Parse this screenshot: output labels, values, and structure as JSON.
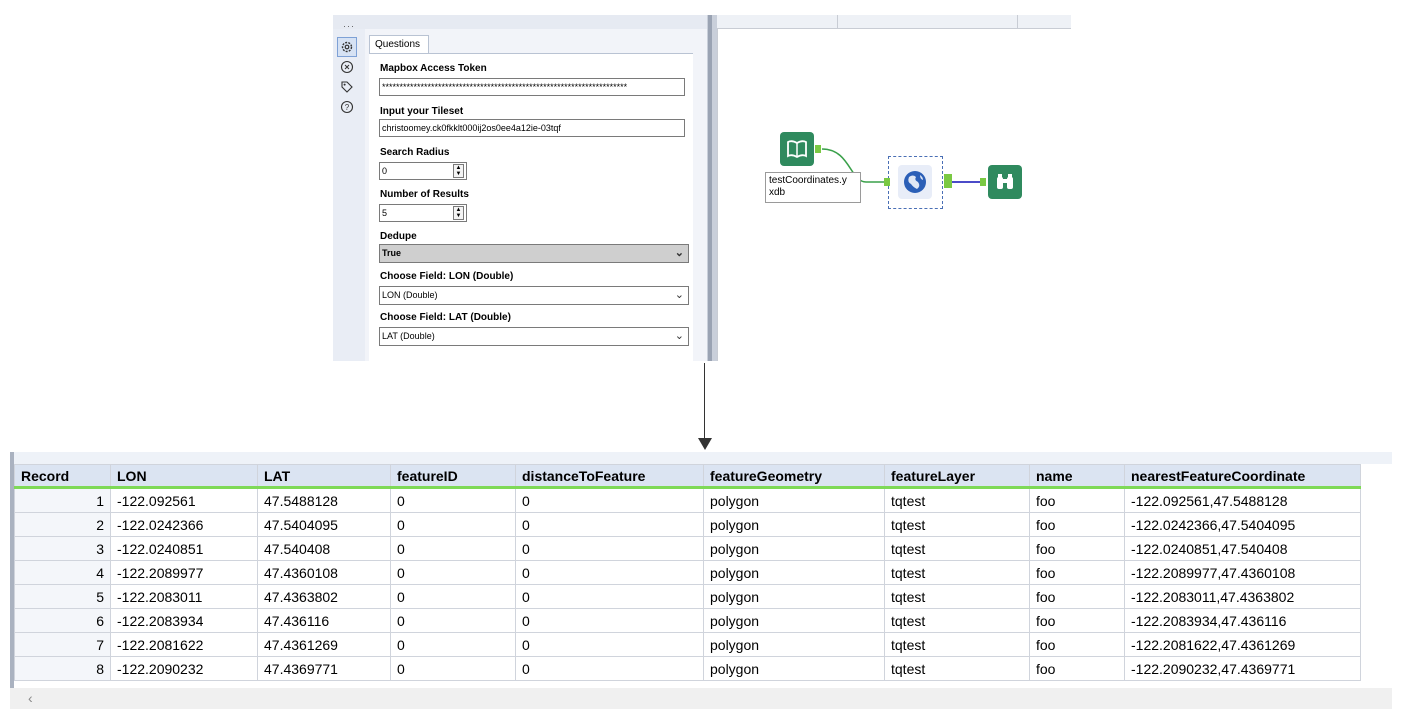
{
  "config": {
    "tab_label": "Questions",
    "fields": {
      "token_label": "Mapbox Access Token",
      "token_value": "**********************************************************************",
      "tileset_label": "Input your Tileset",
      "tileset_value": "christoomey.ck0fkklt000ij2os0ee4a12ie-03tqf",
      "radius_label": "Search Radius",
      "radius_value": "0",
      "results_label": "Number of Results",
      "results_value": "5",
      "dedupe_label": "Dedupe",
      "dedupe_value": "True",
      "lon_label": "Choose Field: LON (Double)",
      "lon_value": "LON (Double)",
      "lat_label": "Choose Field: LAT (Double)",
      "lat_value": "LAT (Double)"
    },
    "sidebar_icons": [
      "gear-icon",
      "connection-icon",
      "tag-icon",
      "help-icon"
    ]
  },
  "workflow": {
    "input_label_line1": "testCoordinates.y",
    "input_label_line2": "xdb",
    "colors": {
      "input": "#2f8a5e",
      "process": "#2b5fb7",
      "browse": "#2f8a5e",
      "anchor": "#7ac943",
      "connection": "#4b4bc8"
    }
  },
  "results": {
    "columns": [
      "Record",
      "LON",
      "LAT",
      "featureID",
      "distanceToFeature",
      "featureGeometry",
      "featureLayer",
      "name",
      "nearestFeatureCoordinate"
    ],
    "rows": [
      [
        "1",
        "-122.092561",
        "47.5488128",
        "0",
        "0",
        "polygon",
        "tqtest",
        "foo",
        "-122.092561,47.5488128"
      ],
      [
        "2",
        "-122.0242366",
        "47.5404095",
        "0",
        "0",
        "polygon",
        "tqtest",
        "foo",
        "-122.0242366,47.5404095"
      ],
      [
        "3",
        "-122.0240851",
        "47.540408",
        "0",
        "0",
        "polygon",
        "tqtest",
        "foo",
        "-122.0240851,47.540408"
      ],
      [
        "4",
        "-122.2089977",
        "47.4360108",
        "0",
        "0",
        "polygon",
        "tqtest",
        "foo",
        "-122.2089977,47.4360108"
      ],
      [
        "5",
        "-122.2083011",
        "47.4363802",
        "0",
        "0",
        "polygon",
        "tqtest",
        "foo",
        "-122.2083011,47.4363802"
      ],
      [
        "6",
        "-122.2083934",
        "47.436116",
        "0",
        "0",
        "polygon",
        "tqtest",
        "foo",
        "-122.2083934,47.436116"
      ],
      [
        "7",
        "-122.2081622",
        "47.4361269",
        "0",
        "0",
        "polygon",
        "tqtest",
        "foo",
        "-122.2081622,47.4361269"
      ],
      [
        "8",
        "-122.2090232",
        "47.4369771",
        "0",
        "0",
        "polygon",
        "tqtest",
        "foo",
        "-122.2090232,47.4369771"
      ]
    ]
  }
}
